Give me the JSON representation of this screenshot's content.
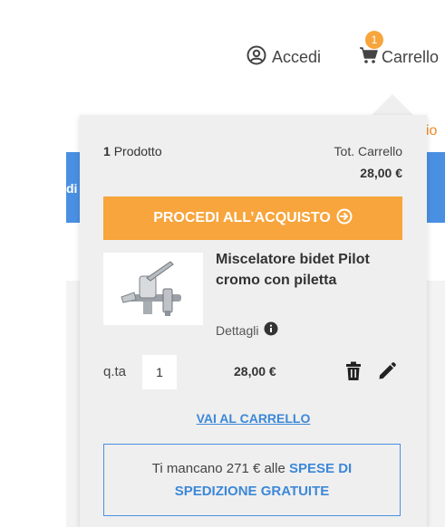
{
  "header": {
    "account_label": "Accedi",
    "cart_label": "Carrello",
    "cart_badge": "1"
  },
  "background": {
    "partial_orange_text": "io",
    "partial_blue_text": "di"
  },
  "popup": {
    "count_number": "1",
    "count_label": "Prodotto",
    "total_label": "Tot. Carrello",
    "total_value": "28,00 €",
    "checkout_label": "PROCEDI ALL’ACQUISTO",
    "product": {
      "name": "Miscelatore bidet Pilot cromo con piletta",
      "details_label": "Dettagli",
      "qty_label": "q.ta",
      "qty_value": "1",
      "price": "28,00 €"
    },
    "go_to_cart_label": "VAI AL CARRELLO",
    "shipping": {
      "prefix": "Ti mancano 271 € alle",
      "highlight": "SPESE DI SPEDIZIONE GRATUITE"
    }
  },
  "colors": {
    "accent_orange": "#f7a53c",
    "link_blue": "#3c88d8",
    "panel_gray": "#efefef"
  },
  "icons": {
    "account": "user-circle-icon",
    "cart": "shopping-cart-icon",
    "checkout_arrow": "arrow-circle-right-icon",
    "details_info": "info-circle-icon",
    "delete": "trash-icon",
    "edit": "pencil-icon"
  }
}
